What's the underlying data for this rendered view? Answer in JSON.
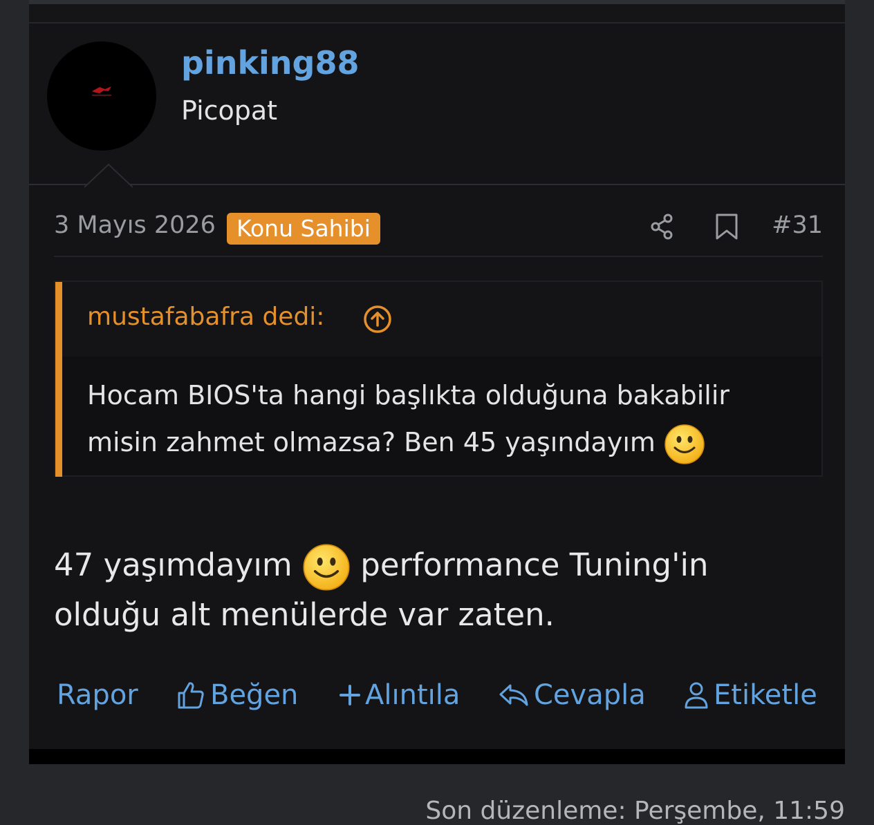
{
  "user": {
    "name": "pinking88",
    "title": "Picopat"
  },
  "post": {
    "date": "3 Mayıs 2026",
    "badge": "Konu Sahibi",
    "number": "#31",
    "share_icon": "share-icon",
    "bookmark_icon": "bookmark-icon"
  },
  "quote": {
    "author": "mustafabafra dedi:",
    "line1": "Hocam BIOS'ta hangi başlıkta olduğuna bakabilir",
    "line2": "misin zahmet olmazsa? Ben 45 yaşındayım"
  },
  "message": {
    "part1": "47 yaşımdayım",
    "part2": "performance Tuning'in",
    "line2": "olduğu alt menülerde var zaten."
  },
  "actions": {
    "report": "Rapor",
    "like": "Beğen",
    "quote": "Alıntıla",
    "reply": "Cevapla",
    "tag": "Etiketle"
  },
  "last_edit": "Son düzenleme: Perşembe, 11:59",
  "colors": {
    "accent": "#e5902a",
    "link": "#62a3e0",
    "background": "#141416"
  }
}
